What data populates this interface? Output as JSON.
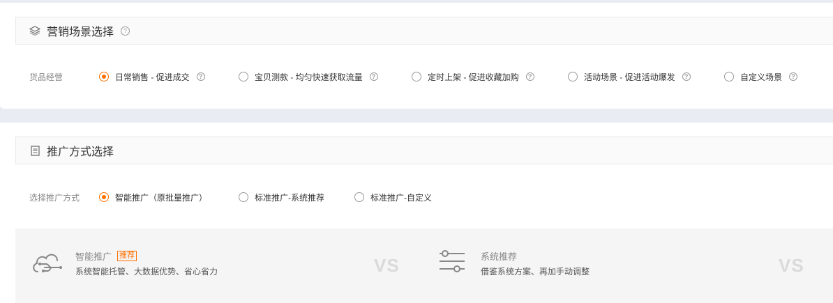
{
  "scene": {
    "title": "营销场景选择",
    "help": "?",
    "row_label": "货品经营",
    "options": [
      {
        "label": "日常销售 - 促进成交",
        "selected": true
      },
      {
        "label": "宝贝测款 - 均匀快速获取流量",
        "selected": false
      },
      {
        "label": "定时上架 - 促进收藏加购",
        "selected": false
      },
      {
        "label": "活动场景 - 促进活动爆发",
        "selected": false
      },
      {
        "label": "自定义场景",
        "selected": false
      }
    ],
    "qmark": "?"
  },
  "promo": {
    "title": "推广方式选择",
    "row_label": "选择推广方式",
    "options": [
      {
        "label": "智能推广（原批量推广）",
        "selected": true
      },
      {
        "label": "标准推广-系统推荐",
        "selected": false
      },
      {
        "label": "标准推广-自定义",
        "selected": false
      }
    ]
  },
  "compare": {
    "items": [
      {
        "title": "智能推广",
        "badge": "推荐",
        "desc": "系统智能托管、大数据优势、省心省力",
        "icon": "cloud-flow-icon"
      },
      {
        "title": "系统推荐",
        "desc": "借鉴系统方案、再加手动调整",
        "icon": "sliders-icon"
      }
    ],
    "vs": "VS"
  },
  "colors": {
    "accent": "#ff7000",
    "page_bg": "#e9ecf3"
  }
}
